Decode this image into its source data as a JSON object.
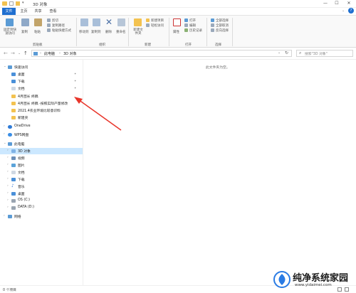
{
  "window": {
    "title": "3D 对象",
    "minimize_glyph": "—",
    "maximize_glyph": "☐",
    "close_glyph": "✕",
    "help_glyph": "?"
  },
  "tabs": [
    {
      "label": "文件",
      "active": true
    },
    {
      "label": "主页",
      "active": false
    },
    {
      "label": "共享",
      "active": false
    },
    {
      "label": "查看",
      "active": false
    }
  ],
  "ribbon": {
    "clipboard": {
      "pin_label": "固定到快速访问",
      "copy_label": "复制",
      "paste_label": "粘贴",
      "cut_label": "剪切",
      "copy_path_label": "复制路径",
      "paste_shortcut_label": "粘贴快捷方式",
      "group_label": "剪贴板"
    },
    "organize": {
      "move_to_label": "移动到",
      "copy_to_label": "复制到",
      "delete_label": "删除",
      "rename_label": "重命名",
      "group_label": "组织"
    },
    "new": {
      "new_folder_label": "新建文件夹",
      "new_item_label": "新建项目",
      "easy_access_label": "轻松访问",
      "group_label": "新建"
    },
    "open": {
      "properties_label": "属性",
      "open_label": "打开",
      "edit_label": "编辑",
      "history_label": "历史记录",
      "group_label": "打开"
    },
    "select": {
      "select_all_label": "全部选择",
      "select_none_label": "全部取消",
      "invert_label": "反向选择",
      "group_label": "选择"
    }
  },
  "address": {
    "back": "←",
    "forward": "→",
    "up": "↑",
    "path_root": "此电脑",
    "path_sep": "›",
    "path_current": "3D 对象",
    "search_placeholder": "搜索\"3D 对象\""
  },
  "nav": {
    "quick_access": "快速访问",
    "quick_items": [
      "桌面",
      "下载",
      "文档",
      "4月团长 终稿",
      "4月团长 终稿 -按照实际产量修改",
      "2021.4农业环境比较意识料",
      "新建夹"
    ],
    "onedrive": "OneDrive",
    "wps": "WPS网盘",
    "this_pc": "此电脑",
    "pc_items": [
      "3D 对象",
      "视频",
      "图片",
      "文档",
      "下载",
      "音乐",
      "桌面",
      "OS (C:)",
      "DATA (D:)"
    ],
    "network": "网络"
  },
  "content": {
    "empty_message": "此文件夹为空。"
  },
  "status": {
    "item_count": "0 个项目"
  },
  "watermark": {
    "line1": "纯净系统家园",
    "line2": "www.yidaimei.com"
  },
  "colors": {
    "accent": "#1f6fd0",
    "selection": "#cce8ff",
    "folder": "#f3c250",
    "arrow": "#e8352a"
  }
}
